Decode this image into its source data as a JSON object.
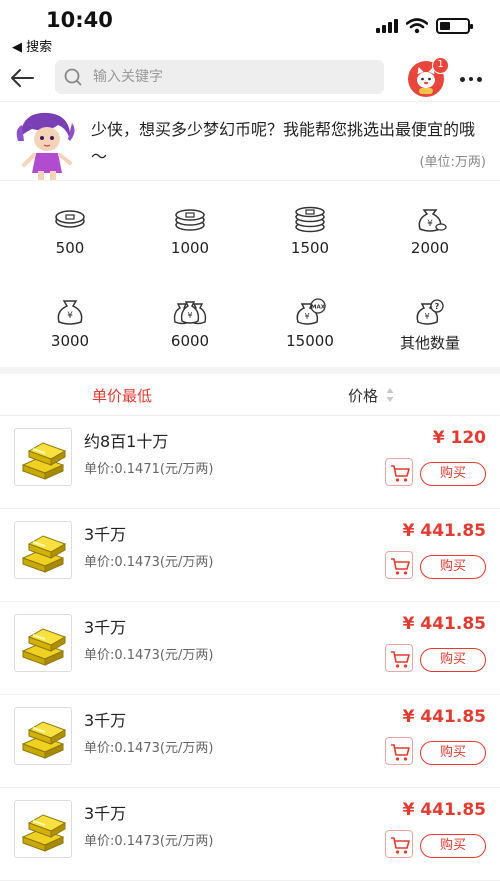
{
  "status": {
    "time": "10:40",
    "back_app": "◀ 搜索"
  },
  "search": {
    "placeholder": "输入关键字",
    "badge_count": "1"
  },
  "intro": {
    "text": "少侠，想买多少梦幻币呢？我能帮您挑选出最便宜的哦～",
    "unit": "(单位:万两)"
  },
  "amounts": [
    {
      "label": "500",
      "icon": "coin-stack-1-icon"
    },
    {
      "label": "1000",
      "icon": "coin-stack-2-icon"
    },
    {
      "label": "1500",
      "icon": "coin-stack-3-icon"
    },
    {
      "label": "2000",
      "icon": "money-bag-icon"
    },
    {
      "label": "3000",
      "icon": "money-bag-yen-icon"
    },
    {
      "label": "6000",
      "icon": "money-bags-icon"
    },
    {
      "label": "15000",
      "icon": "money-bag-max-icon"
    },
    {
      "label": "其他数量",
      "icon": "money-bag-question-icon"
    }
  ],
  "sort": {
    "lowest_label": "单价最低",
    "price_label": "价格"
  },
  "products": [
    {
      "title": "约8百1十万",
      "unit_price": "单价:0.1471(元/万两)",
      "price": "¥ 120",
      "buy": "购买"
    },
    {
      "title": "3千万",
      "unit_price": "单价:0.1473(元/万两)",
      "price": "¥ 441.85",
      "buy": "购买"
    },
    {
      "title": "3千万",
      "unit_price": "单价:0.1473(元/万两)",
      "price": "¥ 441.85",
      "buy": "购买"
    },
    {
      "title": "3千万",
      "unit_price": "单价:0.1473(元/万两)",
      "price": "¥ 441.85",
      "buy": "购买"
    },
    {
      "title": "3千万",
      "unit_price": "单价:0.1473(元/万两)",
      "price": "¥ 441.85",
      "buy": "购买"
    }
  ],
  "colors": {
    "accent": "#e23b31",
    "search_bg": "#eeeeee",
    "separator": "#f4f4f4"
  },
  "battery_level": 0.4
}
